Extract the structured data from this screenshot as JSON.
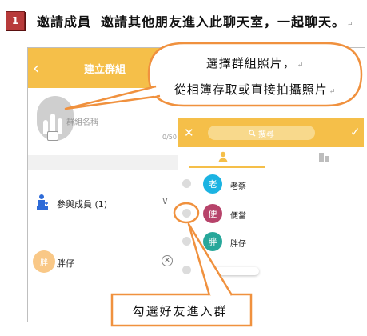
{
  "header": {
    "step_number": "1",
    "title": "邀請成員",
    "description": "邀請其他朋友進入此聊天室，一起聊天。",
    "para_mark": "↵"
  },
  "create_group_screen": {
    "back_icon": "‹",
    "title": "建立群組",
    "name_placeholder": "群組名稱",
    "name_counter": "0/50",
    "members_label": "參與成員 (1)",
    "members_chevron": "∨",
    "selected_member": {
      "avatar_text": "胖",
      "name": "胖仔",
      "remove_icon": "✕"
    }
  },
  "friend_picker_screen": {
    "close_icon": "✕",
    "search_placeholder": "搜尋",
    "confirm_icon": "✓",
    "tabs": [
      "person-icon",
      "building-icon"
    ],
    "friends": [
      {
        "avatar_text": "老",
        "name": "老蔡",
        "avatar_color": "#1bb3e2"
      },
      {
        "avatar_text": "便",
        "name": "便當",
        "avatar_color": "#b7436a"
      },
      {
        "avatar_text": "胖",
        "name": "胖仔",
        "avatar_color": "#27a79a"
      }
    ]
  },
  "callouts": {
    "photo_line1": "選擇群組照片，",
    "photo_line2": "從相簿存取或直接拍攝照片",
    "photo_mark1": "↵",
    "photo_mark2": "↵",
    "select_friend": "勾選好友進入群"
  },
  "colors": {
    "accent": "#f5bf49",
    "callout_border": "#f0913e"
  }
}
